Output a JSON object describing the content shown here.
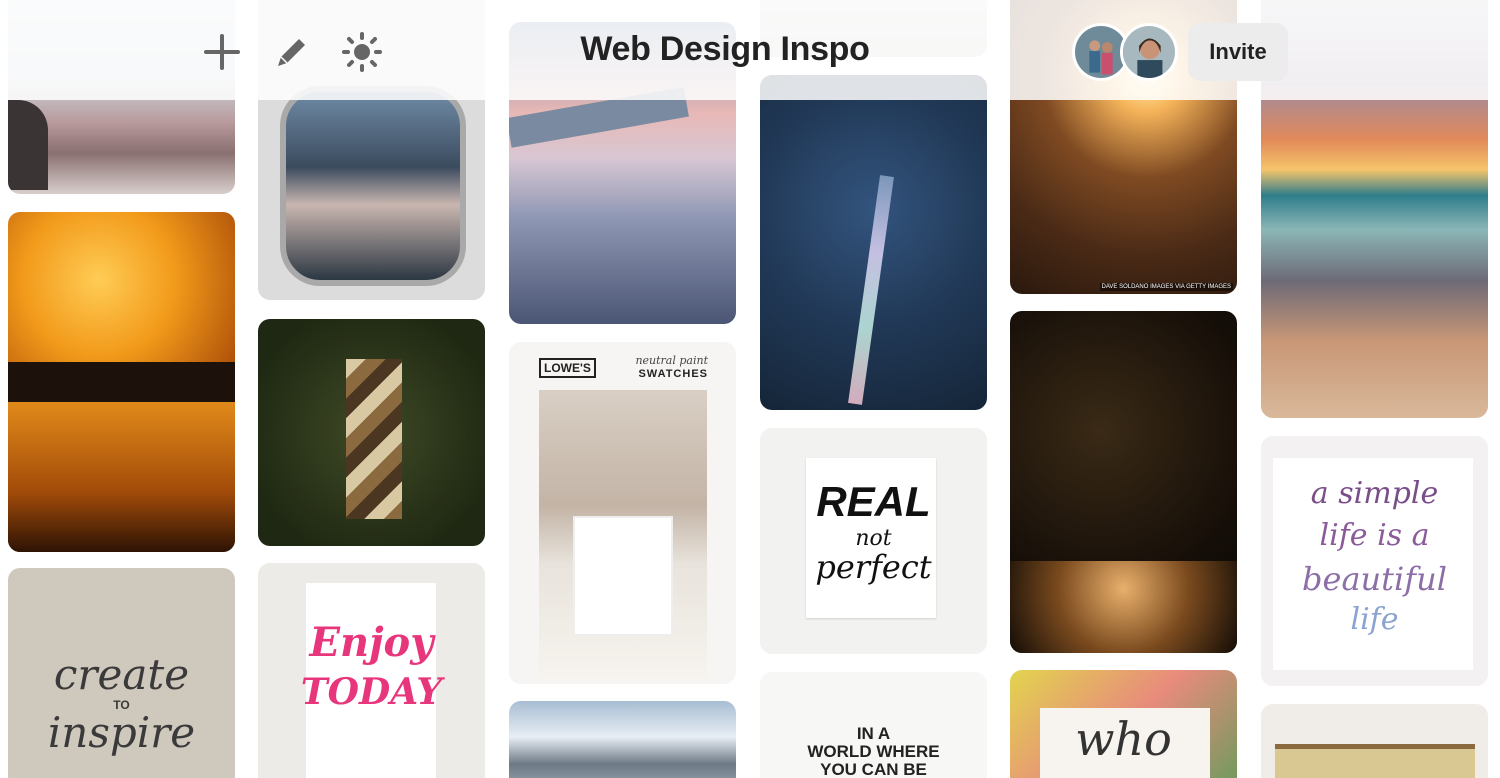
{
  "header": {
    "title": "Web Design Inspo",
    "invite_label": "Invite",
    "tools": [
      {
        "name": "add-icon"
      },
      {
        "name": "pencil-icon"
      },
      {
        "name": "brightness-icon"
      }
    ],
    "collaborators": [
      {
        "name": "collaborator-avatar-1"
      },
      {
        "name": "collaborator-avatar-2"
      }
    ]
  },
  "pins": {
    "lowes": {
      "brand": "LOWE'S",
      "subtitle": "neutral paint",
      "title": "SWATCHES"
    },
    "real": {
      "line1": "REAL",
      "line2": "not",
      "line3": "perfect"
    },
    "create": {
      "line1": "create",
      "line2": "TO",
      "line3": "inspire"
    },
    "enjoy": {
      "line1": "Enjoy",
      "line2": "TODAY"
    },
    "simple": {
      "line1": "a simple",
      "line2": "life is a",
      "line3": "beautiful",
      "line4": "life"
    },
    "world": {
      "line1": "IN A",
      "line2": "WORLD WHERE",
      "line3": "YOU CAN BE"
    },
    "who": {
      "text": "who"
    },
    "credit": {
      "text": "DAVE SOLDANO IMAGES VIA GETTY IMAGES"
    }
  },
  "colors": {
    "title_text": "#222222",
    "invite_bg": "#ececec",
    "icon_gray": "#666666"
  }
}
